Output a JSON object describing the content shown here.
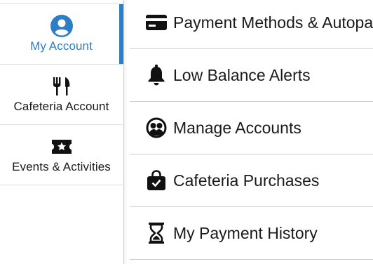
{
  "sidebar": {
    "items": [
      {
        "label": "My Account",
        "icon": "account-circle-icon",
        "active": true
      },
      {
        "label": "Cafeteria Account",
        "icon": "fork-knife-icon",
        "active": false
      },
      {
        "label": "Events & Activities",
        "icon": "ticket-star-icon",
        "active": false
      }
    ]
  },
  "menu": {
    "items": [
      {
        "label": "Payment Methods & Autopay",
        "icon": "credit-card-icon"
      },
      {
        "label": "Low Balance Alerts",
        "icon": "bell-icon"
      },
      {
        "label": "Manage Accounts",
        "icon": "people-circle-icon"
      },
      {
        "label": "Cafeteria Purchases",
        "icon": "shopping-bag-check-icon"
      },
      {
        "label": "My Payment History",
        "icon": "hourglass-icon"
      }
    ]
  },
  "colors": {
    "accent": "#2d7ec3",
    "text": "#1a1a1a",
    "divider": "#dcdcdc"
  }
}
